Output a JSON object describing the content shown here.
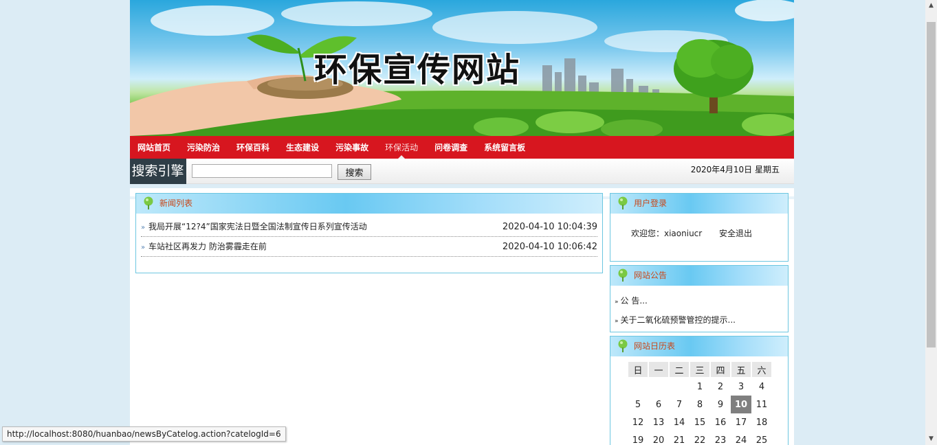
{
  "banner": {
    "title": "环保宣传网站"
  },
  "nav": {
    "items": [
      {
        "label": "网站首页"
      },
      {
        "label": "污染防治"
      },
      {
        "label": "环保百科"
      },
      {
        "label": "生态建设"
      },
      {
        "label": "污染事故"
      },
      {
        "label": "环保活动"
      },
      {
        "label": "问卷调查"
      },
      {
        "label": "系统留言板"
      }
    ],
    "active_index": 5
  },
  "search": {
    "label": "搜索引擎",
    "value": "",
    "button": "搜索"
  },
  "date": "2020年4月10日 星期五",
  "news": {
    "title": "新闻列表",
    "items": [
      {
        "title": "我局开展“12?4”国家宪法日暨全国法制宣传日系列宣传活动",
        "time": "2020-04-10 10:04:39"
      },
      {
        "title": "车站社区再发力 防治雾霾走在前",
        "time": "2020-04-10 10:06:42"
      }
    ]
  },
  "login": {
    "title": "用户登录",
    "welcome": "欢迎您：xiaoniucr",
    "logout": "安全退出"
  },
  "notice": {
    "title": "网站公告",
    "items": [
      {
        "label": "公 告..."
      },
      {
        "label": "关于二氧化硫预警管控的提示..."
      }
    ]
  },
  "calendar": {
    "title": "网站日历表",
    "weekdays": [
      "日",
      "一",
      "二",
      "三",
      "四",
      "五",
      "六"
    ],
    "weeks": [
      [
        "",
        "",
        "",
        "1",
        "2",
        "3",
        "4"
      ],
      [
        "5",
        "6",
        "7",
        "8",
        "9",
        "10",
        "11"
      ],
      [
        "12",
        "13",
        "14",
        "15",
        "16",
        "17",
        "18"
      ],
      [
        "19",
        "20",
        "21",
        "22",
        "23",
        "24",
        "25"
      ]
    ],
    "today": "10"
  },
  "status_url": "http://localhost:8080/huanbao/newsByCatelog.action?catelogId=6",
  "colors": {
    "nav": "#d7161f",
    "panel_border": "#6cc6e0",
    "panel_title": "#c8471a",
    "page_bg": "#dcecf5"
  }
}
